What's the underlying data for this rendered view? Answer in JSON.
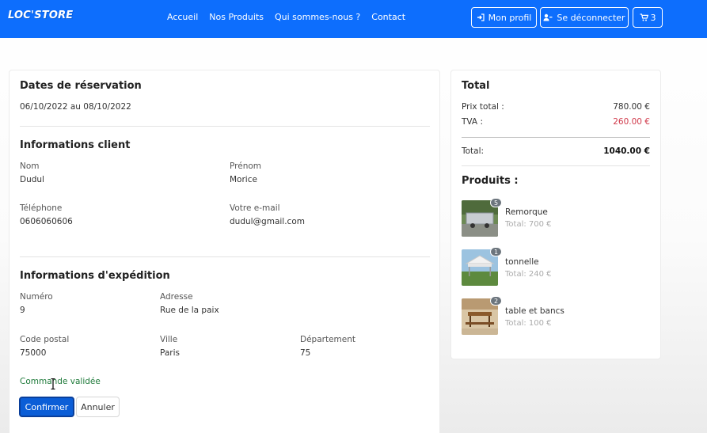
{
  "navbar": {
    "brand": "LOC'STORE",
    "links": [
      "Accueil",
      "Nos Produits",
      "Qui sommes-nous ?",
      "Contact"
    ],
    "profile_label": "Mon profil",
    "logout_label": "Se déconnecter",
    "cart_count": "3"
  },
  "reservation": {
    "title": "Dates de réservation",
    "dates": "06/10/2022 au 08/10/2022"
  },
  "client": {
    "title": "Informations client",
    "nom_label": "Nom",
    "nom_value": "Dudul",
    "prenom_label": "Prénom",
    "prenom_value": "Morice",
    "tel_label": "Téléphone",
    "tel_value": "0606060606",
    "email_label": "Votre e-mail",
    "email_value": "dudul@gmail.com"
  },
  "shipping": {
    "title": "Informations d'expédition",
    "numero_label": "Numéro",
    "numero_value": "9",
    "adresse_label": "Adresse",
    "adresse_value": "Rue de la paix",
    "cp_label": "Code postal",
    "cp_value": "75000",
    "ville_label": "Ville",
    "ville_value": "Paris",
    "dept_label": "Département",
    "dept_value": "75"
  },
  "status": "Commande validée",
  "actions": {
    "confirm_label": "Confirmer",
    "cancel_label": "Annuler"
  },
  "total": {
    "title": "Total",
    "prix_label": "Prix total :",
    "prix_value": "780.00 €",
    "tva_label": "TVA :",
    "tva_value": "260.00 €",
    "total_label": "Total:",
    "total_value": "1040.00 €"
  },
  "products": {
    "title": "Produits :",
    "items": [
      {
        "name": "Remorque",
        "price": "Total: 700 €",
        "qty": "5"
      },
      {
        "name": "tonnelle",
        "price": "Total: 240 €",
        "qty": "1"
      },
      {
        "name": "table et bancs",
        "price": "Total: 100 €",
        "qty": "2"
      }
    ]
  },
  "colors": {
    "primary": "#0d6efd",
    "tva": "#d0394a",
    "success": "#1e7a3a"
  }
}
